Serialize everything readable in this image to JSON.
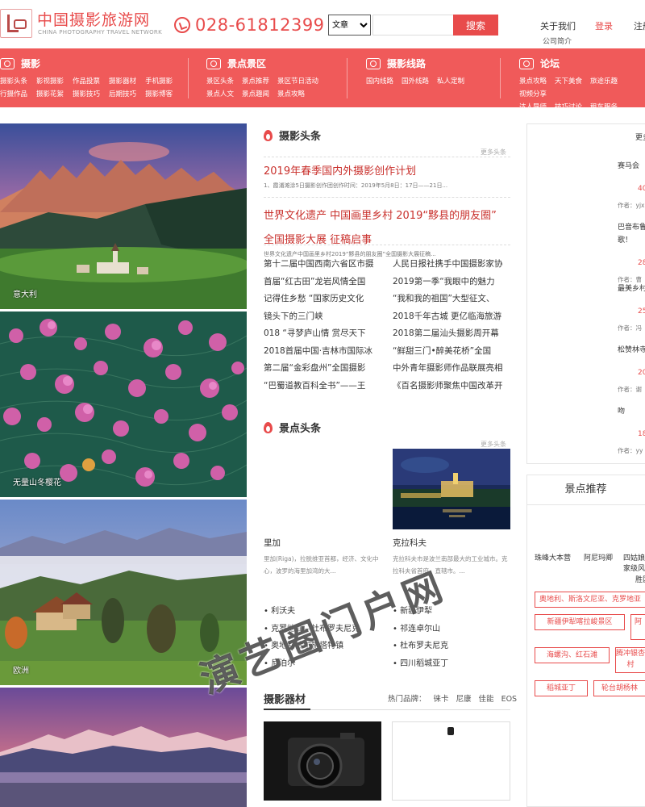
{
  "header": {
    "logo_cn": "中国摄影旅游网",
    "logo_en": "CHINA PHOTOGRAPHY TRAVEL NETWORK",
    "phone": "028-61812399",
    "search_select": "文章",
    "search_button": "搜索",
    "about": "关于我们",
    "login": "登录",
    "register": "注册",
    "company": "公司简介"
  },
  "nav": [
    {
      "title": "摄影",
      "links": [
        "摄影头条",
        "影视摄影",
        "作品投票",
        "摄影器材",
        "手机摄影",
        "行摄作品",
        "摄影花絮",
        "摄影技巧",
        "后期技巧",
        "摄影博客"
      ]
    },
    {
      "title": "景点景区",
      "links": [
        "景区头条",
        "景点推荐",
        "景区节日活动",
        "景点人文",
        "景点趣闻",
        "景点攻略"
      ]
    },
    {
      "title": "摄影线路",
      "links": [
        "国内线路",
        "国外线路",
        "私人定制"
      ]
    },
    {
      "title": "论坛",
      "links": [
        "景点攻略",
        "天下美食",
        "旅途乐趣",
        "视频分享",
        "达人导师",
        "技巧讨论",
        "租车服务",
        "闲置物品"
      ]
    }
  ],
  "photos": [
    {
      "caption": "意大利"
    },
    {
      "caption": "无量山冬樱花"
    },
    {
      "caption": "欧洲"
    },
    {
      "caption": ""
    }
  ],
  "photo_news": {
    "title": "摄影头条",
    "more": "更多头条",
    "headlines": [
      {
        "title": "2019年春季国内外摄影创作计划",
        "summary": "1、霞浦滩涂5日摄影创作团创作时间：2019年5月8日：17日——21日..."
      },
      {
        "title": "世界文化遗产 中国画里乡村 2019“黟县的朋友圈”",
        "summary": ""
      },
      {
        "title": "全国摄影大展 征稿启事",
        "summary": "世界文化遗产中国画里乡村2019“黟县的朋友圈”全国摄影大展征稿..."
      }
    ],
    "left_list": [
      "第十二届中国西南六省区市摄",
      "首届“红古田”龙岩风情全国",
      "记得住乡愁 “国家历史文化",
      "镜头下的三门峡",
      "018 “寻梦庐山情 赏尽天下",
      "2018首届中国·吉林市国际冰",
      "第二届“金彩盘州”全国摄影",
      "“巴蜀道教百科全书”——王"
    ],
    "right_list": [
      "人民日报社携手中国摄影家协",
      "2019第一季“我眼中的魅力",
      "“我和我的祖国”大型征文、",
      "2018千年古城 更亿临海旅游",
      "2018第二届汕头摄影周开幕",
      "“鲜甜三门•醉美花桥”全国",
      "中外青年摄影师作品联展亮相",
      "《百名摄影师聚焦中国改革开"
    ]
  },
  "spot_news": {
    "title": "景点头条",
    "more": "更多头条",
    "cards": [
      {
        "name": "里加",
        "desc": "里加(Riga)，拉脱维亚首都，经济、文化中心，波罗的海里加湾的大..."
      },
      {
        "name": "克拉科夫",
        "desc": "克拉科夫市是波兰南部最大的工业城市。克拉科夫省首府，直辖市。..."
      }
    ],
    "left_list": [
      "利沃夫",
      "克罗地亚—杜布罗夫尼克",
      "奥地利哈尔施塔特镇",
      "尼泊尔"
    ],
    "right_list": [
      "新疆伊犁",
      "祁连卓尔山",
      "杜布罗夫尼克",
      "四川稻城亚丁"
    ]
  },
  "gear": {
    "title": "摄影器材",
    "tags_label": "热门品牌：",
    "tags": [
      "徕卡",
      "尼康",
      "佳能",
      "EOS"
    ]
  },
  "sidebar": {
    "more": "更多",
    "items": [
      {
        "text": "赛马会",
        "date": "",
        "author": ""
      },
      {
        "text": "",
        "date": "40",
        "author": "作者：yjx"
      },
      {
        "text": "巴音布鲁",
        "date": "",
        "author": ""
      },
      {
        "text": "歌！",
        "date": "",
        "author": ""
      },
      {
        "text": "",
        "date": "28",
        "author": "作者：曹"
      },
      {
        "text": "最美乡村",
        "date": "",
        "author": ""
      },
      {
        "text": "",
        "date": "25",
        "author": "作者：冯"
      },
      {
        "text": "松赞林寺",
        "date": "",
        "author": ""
      },
      {
        "text": "",
        "date": "20",
        "author": "作者：谢"
      },
      {
        "text": "吻",
        "date": "",
        "author": ""
      },
      {
        "text": "",
        "date": "18",
        "author": "作者：yy"
      }
    ]
  },
  "recommend": {
    "title": "景点推荐",
    "names": [
      "珠峰大本营",
      "阿尼玛卿",
      "四姑娘山",
      "家级风景区",
      "胜区"
    ],
    "tags": [
      "奥地利、斯洛文尼亚、克罗地亚",
      "新疆伊犁喀拉峻景区",
      "阿",
      "海螺沟、红石滩",
      "腾冲银杏村",
      "稻城亚丁",
      "轮台胡杨林"
    ]
  },
  "watermark": "演艺圈门户网",
  "colors": {
    "brand": "#f05a5a",
    "accent": "#e84b4b",
    "headline": "#c9302c"
  }
}
